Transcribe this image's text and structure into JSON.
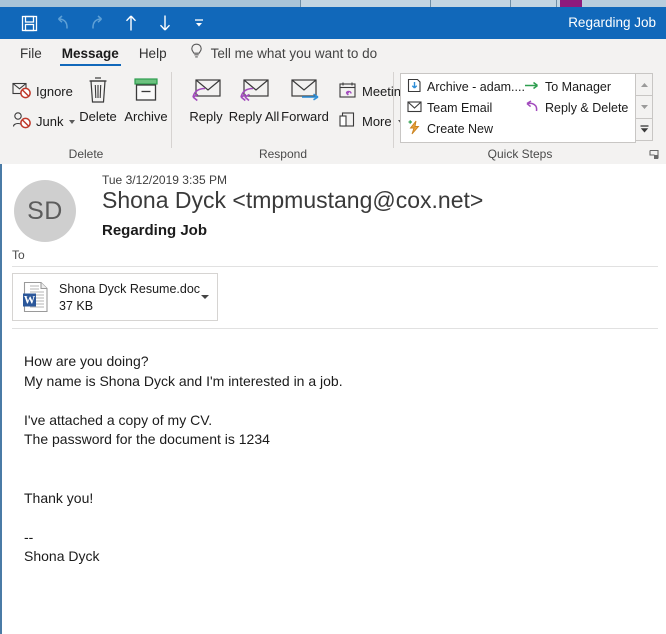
{
  "window": {
    "title": "Regarding Job",
    "accent_color": "#1168ba",
    "ribbon_background": "#f3f2f1"
  },
  "quick_access_toolbar": {
    "items": [
      {
        "name": "save-icon",
        "label": "Save",
        "enabled": true
      },
      {
        "name": "undo-icon",
        "label": "Undo",
        "enabled": false
      },
      {
        "name": "redo-icon",
        "label": "Redo",
        "enabled": false
      },
      {
        "name": "previous-item-icon",
        "label": "Previous Item",
        "enabled": true
      },
      {
        "name": "next-item-icon",
        "label": "Next Item",
        "enabled": true
      },
      {
        "name": "customize-quick-access-toolbar-icon",
        "label": "Customize Quick Access Toolbar",
        "enabled": true
      }
    ]
  },
  "ribbon_tabs": {
    "file": "File",
    "message": "Message",
    "help": "Help",
    "tell_me": "Tell me what you want to do",
    "active_tab": "Message"
  },
  "ribbon": {
    "groups": [
      {
        "title": "Delete",
        "buttons": [
          {
            "label": "Ignore",
            "icon": "ignore-icon"
          },
          {
            "label": "Junk",
            "icon": "junk-icon",
            "has_dropdown": true
          },
          {
            "label": "Delete",
            "icon": "delete-icon"
          },
          {
            "label": "Archive",
            "icon": "archive-icon"
          }
        ]
      },
      {
        "title": "Respond",
        "buttons": [
          {
            "label": "Reply",
            "icon": "reply-icon"
          },
          {
            "label": "Reply All",
            "icon": "reply-all-icon"
          },
          {
            "label": "Forward",
            "icon": "forward-icon"
          },
          {
            "label": "Meeting",
            "icon": "meeting-icon"
          },
          {
            "label": "More",
            "icon": "more-icon",
            "has_dropdown": true
          }
        ]
      },
      {
        "title": "Quick Steps",
        "items": [
          {
            "label": "Archive - adam....",
            "icon": "move-to-folder-icon"
          },
          {
            "label": "Team Email",
            "icon": "envelope-icon"
          },
          {
            "label": "Create New",
            "icon": "create-new-icon"
          },
          {
            "label": "To Manager",
            "icon": "forward-arrow-icon"
          },
          {
            "label": "Reply & Delete",
            "icon": "reply-arrow-icon"
          }
        ]
      }
    ]
  },
  "message": {
    "avatar_initials": "SD",
    "date": "Tue 3/12/2019 3:35 PM",
    "from": "Shona Dyck <tmpmustang@cox.net>",
    "subject": "Regarding Job",
    "to_label": "To",
    "to_value": "",
    "attachment": {
      "filename": "Shona Dyck Resume.doc",
      "size": "37 KB",
      "icon": "word-document-icon"
    },
    "body_lines": [
      "How are you doing?",
      "My name is Shona Dyck and I'm interested in a job.",
      "",
      "I've attached a copy of my CV.",
      "The password for the document is 1234",
      "",
      "",
      "Thank you!",
      "",
      "--",
      "Shona Dyck"
    ]
  }
}
